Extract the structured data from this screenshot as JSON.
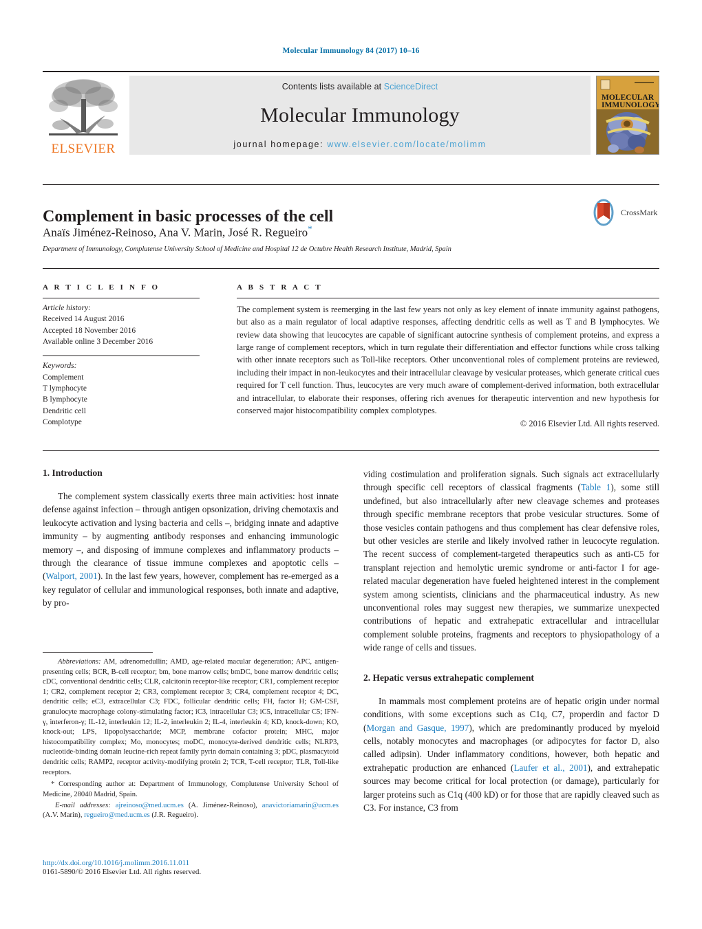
{
  "running_head": "Molecular Immunology 84 (2017) 10–16",
  "masthead": {
    "publisher": "ELSEVIER",
    "contents_prefix": "Contents lists available at ",
    "contents_link": "ScienceDirect",
    "journal_name": "Molecular Immunology",
    "homepage_prefix": "journal homepage: ",
    "homepage_url": "www.elsevier.com/locate/molimm",
    "cover_title_line1": "MOLECULAR",
    "cover_title_line2": "IMMUNOLOGY"
  },
  "title_block": {
    "title": "Complement in basic processes of the cell",
    "authors": "Anaïs Jiménez-Reinoso, Ana V. Marin, José R. Regueiro",
    "corresponding_marker": "*",
    "affiliation": "Department of Immunology, Complutense University School of Medicine and Hospital 12 de Octubre Health Research Institute, Madrid, Spain",
    "crossmark_label": "CrossMark"
  },
  "article_info": {
    "heading": "A R T I C L E   I N F O",
    "history_label": "Article history:",
    "received": "Received 14 August 2016",
    "accepted": "Accepted 18 November 2016",
    "available": "Available online 3 December 2016",
    "keywords_label": "Keywords:",
    "keywords": [
      "Complement",
      "T lymphocyte",
      "B lymphocyte",
      "Dendritic cell",
      "Complotype"
    ]
  },
  "abstract": {
    "heading": "A B S T R A C T",
    "text": "The complement system is reemerging in the last few years not only as key element of innate immunity against pathogens, but also as a main regulator of local adaptive responses, affecting dendritic cells as well as T and B lymphocytes. We review data showing that leucocytes are capable of significant autocrine synthesis of complement proteins, and express a large range of complement receptors, which in turn regulate their differentiation and effector functions while cross talking with other innate receptors such as Toll-like receptors. Other unconventional roles of complement proteins are reviewed, including their impact in non-leukocytes and their intracellular cleavage by vesicular proteases, which generate critical cues required for T cell function. Thus, leucocytes are very much aware of complement-derived information, both extracellular and intracellular, to elaborate their responses, offering rich avenues for therapeutic intervention and new hypothesis for conserved major histocompatibility complex complotypes.",
    "copyright": "© 2016 Elsevier Ltd. All rights reserved."
  },
  "body": {
    "section1_heading": "1. Introduction",
    "section1_p1_a": "The complement system classically exerts three main activities: host innate defense against infection – through antigen opsonization, driving chemotaxis and leukocyte activation and lysing bacteria and cells –, bridging innate and adaptive immunity – by augmenting antibody responses and enhancing immunologic memory –, and disposing of immune complexes and inflammatory products – through the clearance of tissue immune complexes and apoptotic cells – (",
    "section1_ref1": "Walport, 2001",
    "section1_p1_b": "). In the last few years, however, complement has re-emerged as a key regulator of cellular and immunological responses, both innate and adaptive, by pro-",
    "section1_p1_cont_a": "viding costimulation and proliferation signals. Such signals act extracellularly through specific cell receptors of classical fragments (",
    "section1_ref2": "Table 1",
    "section1_p1_cont_b": "), some still undefined, but also intracellularly after new cleavage schemes and proteases through specific membrane receptors that probe vesicular structures. Some of those vesicles contain pathogens and thus complement has clear defensive roles, but other vesicles are sterile and likely involved rather in leucocyte regulation. The recent success of complement-targeted therapeutics such as anti-C5 for transplant rejection and hemolytic uremic syndrome or anti-factor I for age-related macular degeneration have fueled heightened interest in the complement system among scientists, clinicians and the pharmaceutical industry. As new unconventional roles may suggest new therapies, we summarize unexpected contributions of hepatic and extrahepatic extracellular and intracellular complement soluble proteins, fragments and receptors to physiopathology of a wide range of cells and tissues.",
    "section2_heading": "2. Hepatic versus extrahepatic complement",
    "section2_p1_a": "In mammals most complement proteins are of hepatic origin under normal conditions, with some exceptions such as C1q, C7, properdin and factor D (",
    "section2_ref1": "Morgan and Gasque, 1997",
    "section2_p1_b": "), which are predominantly produced by myeloid cells, notably monocytes and macrophages (or adipocytes for factor D, also called adipsin). Under inflammatory conditions, however, both hepatic and extrahepatic production are enhanced (",
    "section2_ref2": "Laufer et al., 2001",
    "section2_p1_c": "), and extrahepatic sources may become critical for local protection (or damage), particularly for larger proteins such as C1q (400 kD) or for those that are rapidly cleaved such as C3. For instance, C3 from"
  },
  "footnotes": {
    "abbrev_label": "Abbreviations:",
    "abbrev_text": " AM, adrenomedullin; AMD, age-related macular degeneration; APC, antigen-presenting cells; BCR, B-cell receptor; bm, bone marrow cells; bmDC, bone marrow dendritic cells; cDC, conventional dendritic cells; CLR, calcitonin receptor-like receptor; CR1, complement receptor 1; CR2, complement receptor 2; CR3, complement receptor 3; CR4, complement receptor 4; DC, dendritic cells; eC3, extracellular C3; FDC, follicular dendritic cells; FH, factor H; GM-CSF, granulocyte macrophage colony-stimulating factor; iC3, intracellular C3; iC5, intracellular C5; IFN-γ, interferon-γ; IL-12, interleukin 12; IL-2, interleukin 2; IL-4, interleukin 4; KD, knock-down; KO, knock-out; LPS, lipopolysaccharide; MCP, membrane cofactor protein; MHC, major histocompatibility complex; Mo, monocytes; moDC, monocyte-derived dendritic cells; NLRP3, nucleotide-binding domain leucine-rich repeat family pyrin domain containing 3; pDC, plasmacytoid dendritic cells; RAMP2, receptor activity-modifying protein 2; TCR, T-cell receptor; TLR, Toll-like receptors.",
    "corresponding_marker": "*",
    "corresponding_text": " Corresponding author at: Department of Immunology, Complutense University School of Medicine, 28040 Madrid, Spain.",
    "email_label": "E-mail addresses:",
    "email1": "ajreinoso@med.ucm.es",
    "email1_name": " (A. Jiménez-Reinoso), ",
    "email2": "anavictoriamarin@ucm.es",
    "email2_name": " (A.V. Marin), ",
    "email3": "regueiro@med.ucm.es",
    "email3_name": " (J.R. Regueiro)."
  },
  "doi_block": {
    "doi_url": "http://dx.doi.org/10.1016/j.molimm.2016.11.011",
    "issn_line": "0161-5890/© 2016 Elsevier Ltd. All rights reserved."
  },
  "colors": {
    "link_blue": "#1f7fc0",
    "header_blue": "#0b72a8",
    "elsevier_orange": "#ee7623",
    "masthead_grey": "#e8e8e8"
  }
}
